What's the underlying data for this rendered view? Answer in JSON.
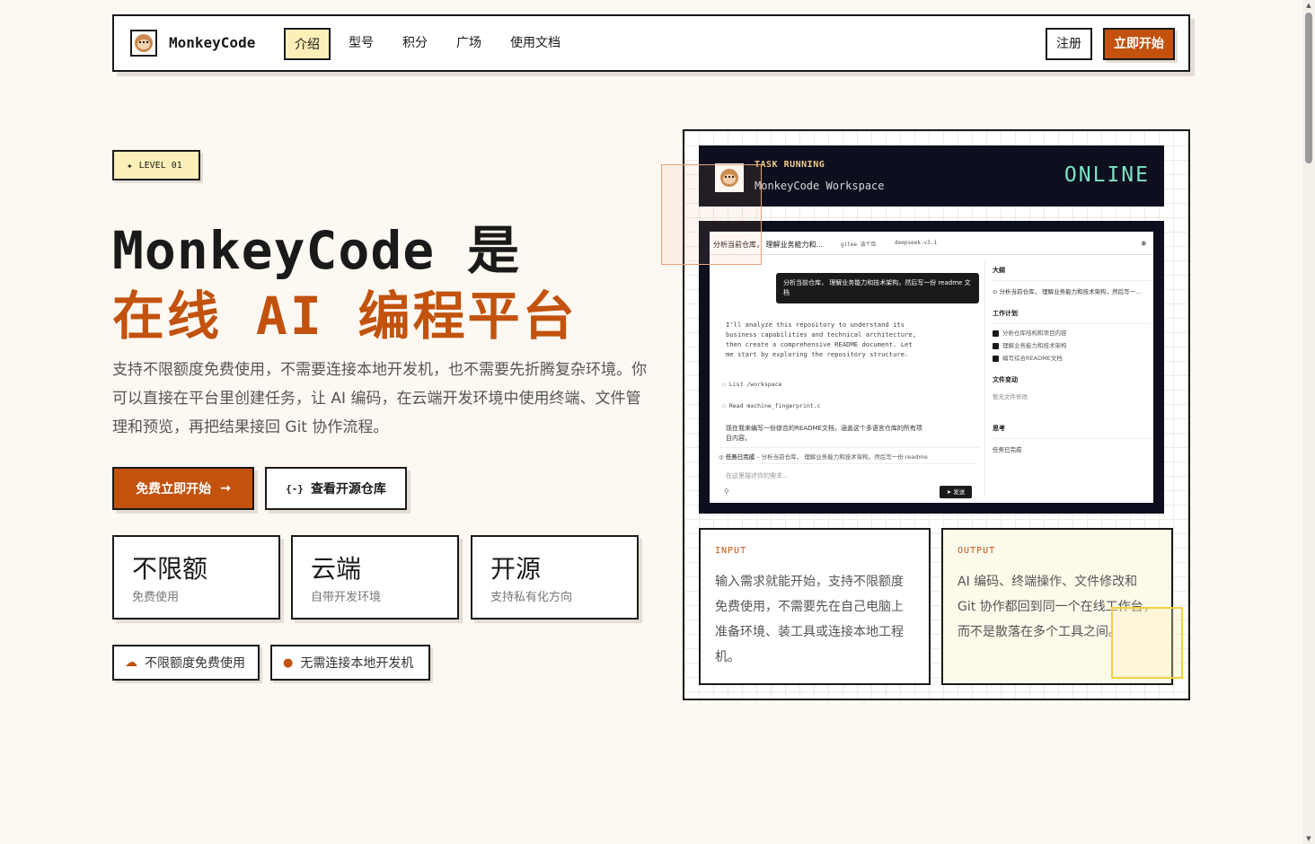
{
  "nav": {
    "brand": "MonkeyCode",
    "items": [
      "介绍",
      "型号",
      "积分",
      "广场",
      "使用文档"
    ],
    "active_index": 0,
    "register": "注册",
    "start": "立即开始"
  },
  "hero": {
    "badge": "LEVEL 01",
    "title_line1": "MonkeyCode 是",
    "title_line2": "在线 AI 编程平台",
    "description": "支持不限额度免费使用，不需要连接本地开发机，也不需要先折腾复杂环境。你可以直接在平台里创建任务，让 AI 编码，在云端开发环境中使用终端、文件管理和预览，再把结果接回 Git 协作流程。",
    "cta_primary": "免费立即开始",
    "cta_primary_arrow": "→",
    "cta_secondary_icon": "{-}",
    "cta_secondary": "查看开源仓库"
  },
  "stats": [
    {
      "big": "不限额",
      "small": "免费使用"
    },
    {
      "big": "云端",
      "small": "自带开发环境"
    },
    {
      "big": "开源",
      "small": "支持私有化方向"
    }
  ],
  "chips": [
    {
      "icon": "cloud-icon",
      "label": "不限额度免费使用"
    },
    {
      "icon": "github-icon",
      "label": "无需连接本地开发机"
    }
  ],
  "workspace": {
    "status_label": "TASK RUNNING",
    "title": "MonkeyCode Workspace",
    "status": "ONLINE",
    "tab_task": "分析当前仓库， 理解业务能力和...",
    "tab_repo": "gitee 该个库",
    "tab_model": "deepseek-v3.1",
    "user_message": "分析当前仓库， 理解业务能力和技术架构，然后写一份 readme 文档",
    "ai_reply": "I'll analyze this repository to understand its business capabilities and technical architecture, then create a comprehensive README document. Let me start by exploring the repository structure.",
    "tool_1": "List /workspace",
    "tool_2": "Read machine_fingerprint.c",
    "cn_reply": "现在我来编写一份综合的README文档，涵盖这个多语言仓库的所有项目内容。",
    "done_label": "任务已完成",
    "done_text": "分析当前仓库， 理解业务能力和技术架构，然后写一份 readme",
    "input_placeholder": "在这里描述你的需求...",
    "send": "发送",
    "side": {
      "outline_h": "大纲",
      "outline_item": "分析当前仓库， 理解业务能力和技术架构，然后写一...",
      "plan_h": "工作计划",
      "plan_items": [
        "分析仓库结构和项目内容",
        "理解业务能力和技术架构",
        "编写综合README文档"
      ],
      "files_h": "文件变动",
      "files_empty": "暂无文件修改",
      "thinking_h": "思考",
      "thinking_text": "任务已完成"
    }
  },
  "io": {
    "input_label": "INPUT",
    "input_text": "输入需求就能开始，支持不限额度免费使用，不需要先在自己电脑上准备环境、装工具或连接本地工程机。",
    "output_label": "OUTPUT",
    "output_text": "AI 编码、终端操作、文件修改和 Git 协作都回到同一个在线工作台，而不是散落在多个工具之间。"
  },
  "colors": {
    "accent": "#c2520d",
    "highlight": "#fdefb8",
    "dark": "#0d0f1e",
    "online": "#7de3c2"
  }
}
